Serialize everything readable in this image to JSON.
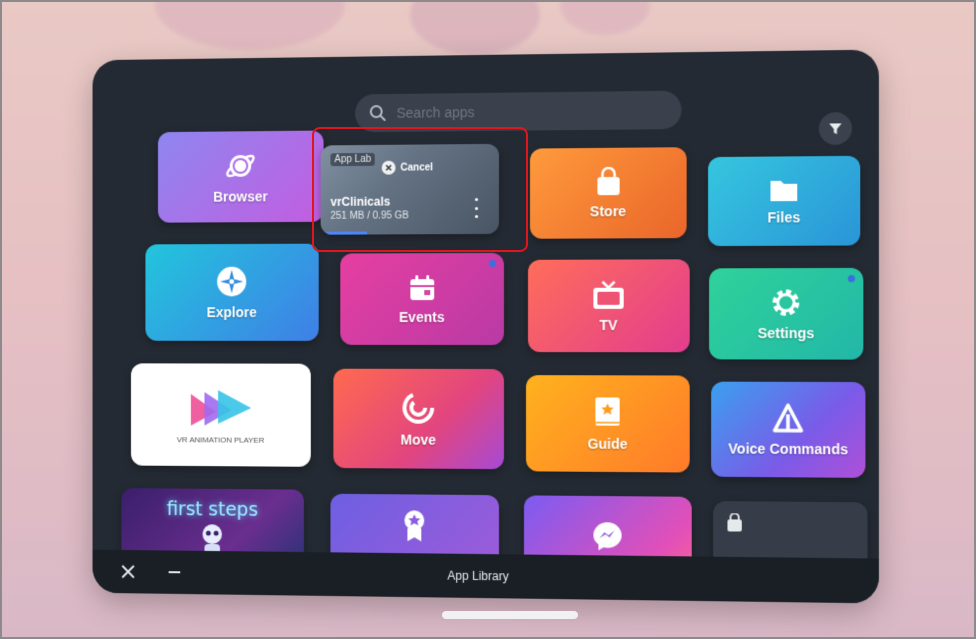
{
  "search": {
    "placeholder": "Search apps"
  },
  "bottom_bar": {
    "title": "App Library"
  },
  "download_tile": {
    "overlay_tag": "App Lab",
    "cancel_label": "Cancel",
    "app_name": "vrClinicals",
    "progress_text": "251 MB / 0.95 GB",
    "progress_fraction": 0.26
  },
  "tiles": {
    "browser": "Browser",
    "store": "Store",
    "files": "Files",
    "explore": "Explore",
    "events": "Events",
    "tv": "TV",
    "settings": "Settings",
    "vr_animation_player": "VR ANIMATION PLAYER",
    "move": "Move",
    "guide": "Guide",
    "voice_commands": "Voice Commands",
    "first_steps": "first steps"
  },
  "colors": {
    "panel": "#242a33",
    "highlight_border": "#e0161d",
    "notification_dot": "#3b6fe0"
  }
}
